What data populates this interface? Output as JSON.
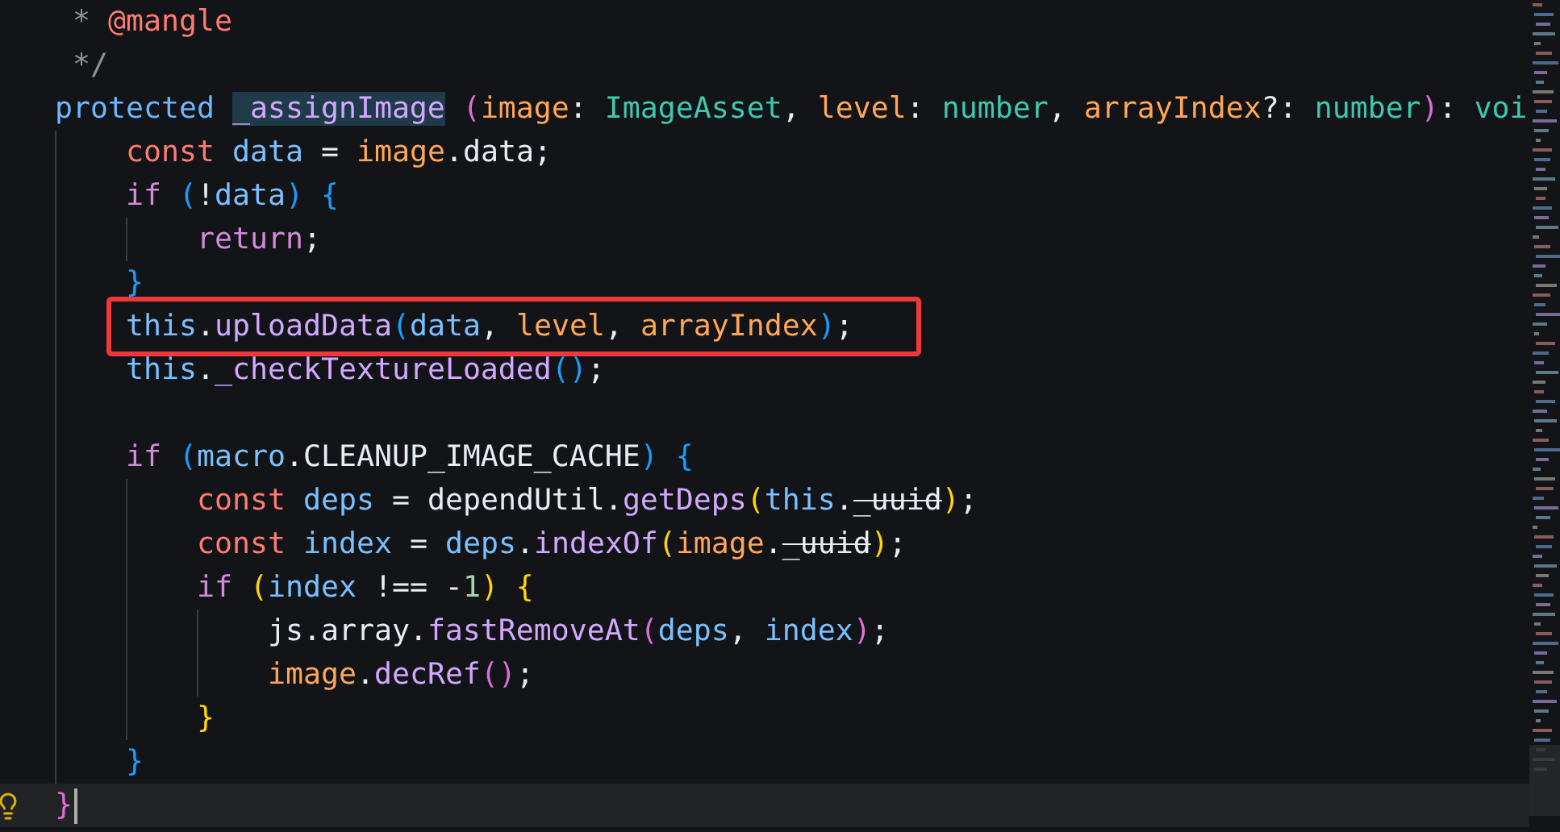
{
  "editor": {
    "lines": [
      {
        "current": false,
        "boxed": false,
        "tokens": [
          {
            "text": " * ",
            "kind": "comment"
          },
          {
            "text": "@mangle",
            "kind": "tag"
          }
        ]
      },
      {
        "current": false,
        "boxed": false,
        "tokens": [
          {
            "text": " */",
            "kind": "comment"
          }
        ]
      },
      {
        "current": false,
        "boxed": false,
        "tokens": [
          {
            "text": "protected ",
            "kind": "storage"
          },
          {
            "text": "_assignImage",
            "kind": "selection"
          },
          {
            "text": " (",
            "kind": "bracket2"
          },
          {
            "text": "image",
            "kind": "param"
          },
          {
            "text": ": ",
            "kind": "plain"
          },
          {
            "text": "ImageAsset",
            "kind": "type"
          },
          {
            "text": ", ",
            "kind": "plain"
          },
          {
            "text": "level",
            "kind": "param"
          },
          {
            "text": ": ",
            "kind": "plain"
          },
          {
            "text": "number",
            "kind": "type"
          },
          {
            "text": ", ",
            "kind": "plain"
          },
          {
            "text": "arrayIndex",
            "kind": "param"
          },
          {
            "text": "?: ",
            "kind": "plain"
          },
          {
            "text": "number",
            "kind": "type"
          },
          {
            "text": ")",
            "kind": "bracket2"
          },
          {
            "text": ": ",
            "kind": "plain"
          },
          {
            "text": "voi",
            "kind": "type"
          }
        ]
      },
      {
        "current": false,
        "boxed": false,
        "tokens": [
          {
            "text": "    const ",
            "kind": "keyword"
          },
          {
            "text": "data",
            "kind": "variable"
          },
          {
            "text": " = ",
            "kind": "plain"
          },
          {
            "text": "image",
            "kind": "param"
          },
          {
            "text": ".data;",
            "kind": "plain"
          }
        ]
      },
      {
        "current": false,
        "boxed": false,
        "tokens": [
          {
            "text": "    if",
            "kind": "control"
          },
          {
            "text": " (",
            "kind": "bracket3"
          },
          {
            "text": "!",
            "kind": "plain"
          },
          {
            "text": "data",
            "kind": "variable"
          },
          {
            "text": ")",
            "kind": "bracket3"
          },
          {
            "text": " {",
            "kind": "bracket3"
          }
        ]
      },
      {
        "current": false,
        "boxed": false,
        "tokens": [
          {
            "text": "        return",
            "kind": "control"
          },
          {
            "text": ";",
            "kind": "plain"
          }
        ]
      },
      {
        "current": false,
        "boxed": false,
        "tokens": [
          {
            "text": "    }",
            "kind": "bracket3"
          }
        ]
      },
      {
        "current": false,
        "boxed": true,
        "tokens": [
          {
            "text": "    this",
            "kind": "variable"
          },
          {
            "text": ".",
            "kind": "plain"
          },
          {
            "text": "uploadData",
            "kind": "function"
          },
          {
            "text": "(",
            "kind": "bracket3"
          },
          {
            "text": "data",
            "kind": "variable"
          },
          {
            "text": ", ",
            "kind": "plain"
          },
          {
            "text": "level",
            "kind": "param"
          },
          {
            "text": ", ",
            "kind": "plain"
          },
          {
            "text": "arrayIndex",
            "kind": "param"
          },
          {
            "text": ")",
            "kind": "bracket3"
          },
          {
            "text": ";",
            "kind": "plain"
          }
        ]
      },
      {
        "current": false,
        "boxed": false,
        "tokens": [
          {
            "text": "    this",
            "kind": "variable"
          },
          {
            "text": ".",
            "kind": "plain"
          },
          {
            "text": "_checkTextureLoaded",
            "kind": "function"
          },
          {
            "text": "()",
            "kind": "bracket3"
          },
          {
            "text": ";",
            "kind": "plain"
          }
        ]
      },
      {
        "kind": "blank"
      },
      {
        "current": false,
        "boxed": false,
        "tokens": [
          {
            "text": "    if",
            "kind": "control"
          },
          {
            "text": " (",
            "kind": "bracket3"
          },
          {
            "text": "macro",
            "kind": "variable"
          },
          {
            "text": ".CLEANUP_IMAGE_CACHE",
            "kind": "plain"
          },
          {
            "text": ")",
            "kind": "bracket3"
          },
          {
            "text": " {",
            "kind": "bracket3"
          }
        ]
      },
      {
        "current": false,
        "boxed": false,
        "tokens": [
          {
            "text": "        const ",
            "kind": "keyword"
          },
          {
            "text": "deps",
            "kind": "variable"
          },
          {
            "text": " = dependUtil.",
            "kind": "plain"
          },
          {
            "text": "getDeps",
            "kind": "function"
          },
          {
            "text": "(",
            "kind": "bracket1"
          },
          {
            "text": "this",
            "kind": "variable"
          },
          {
            "text": ".",
            "kind": "plain"
          },
          {
            "text": "_uuid",
            "kind": "deprecated"
          },
          {
            "text": ")",
            "kind": "bracket1"
          },
          {
            "text": ";",
            "kind": "plain"
          }
        ]
      },
      {
        "current": false,
        "boxed": false,
        "tokens": [
          {
            "text": "        const ",
            "kind": "keyword"
          },
          {
            "text": "index",
            "kind": "variable"
          },
          {
            "text": " = ",
            "kind": "plain"
          },
          {
            "text": "deps",
            "kind": "variable"
          },
          {
            "text": ".",
            "kind": "plain"
          },
          {
            "text": "indexOf",
            "kind": "function"
          },
          {
            "text": "(",
            "kind": "bracket1"
          },
          {
            "text": "image",
            "kind": "param"
          },
          {
            "text": ".",
            "kind": "plain"
          },
          {
            "text": "_uuid",
            "kind": "deprecated"
          },
          {
            "text": ")",
            "kind": "bracket1"
          },
          {
            "text": ";",
            "kind": "plain"
          }
        ]
      },
      {
        "current": false,
        "boxed": false,
        "tokens": [
          {
            "text": "        if",
            "kind": "control"
          },
          {
            "text": " (",
            "kind": "bracket1"
          },
          {
            "text": "index",
            "kind": "variable"
          },
          {
            "text": " !== -",
            "kind": "plain"
          },
          {
            "text": "1",
            "kind": "number"
          },
          {
            "text": ")",
            "kind": "bracket1"
          },
          {
            "text": " {",
            "kind": "bracket1"
          }
        ]
      },
      {
        "current": false,
        "boxed": false,
        "tokens": [
          {
            "text": "            js.array.",
            "kind": "plain"
          },
          {
            "text": "fastRemoveAt",
            "kind": "function"
          },
          {
            "text": "(",
            "kind": "bracket2"
          },
          {
            "text": "deps",
            "kind": "variable"
          },
          {
            "text": ", ",
            "kind": "plain"
          },
          {
            "text": "index",
            "kind": "variable"
          },
          {
            "text": ")",
            "kind": "bracket2"
          },
          {
            "text": ";",
            "kind": "plain"
          }
        ]
      },
      {
        "current": false,
        "boxed": false,
        "tokens": [
          {
            "text": "            image",
            "kind": "param"
          },
          {
            "text": ".",
            "kind": "plain"
          },
          {
            "text": "decRef",
            "kind": "function"
          },
          {
            "text": "()",
            "kind": "bracket2"
          },
          {
            "text": ";",
            "kind": "plain"
          }
        ]
      },
      {
        "current": false,
        "boxed": false,
        "tokens": [
          {
            "text": "        }",
            "kind": "bracket1"
          }
        ]
      },
      {
        "current": false,
        "boxed": false,
        "tokens": [
          {
            "text": "    }",
            "kind": "bracket3"
          }
        ]
      },
      {
        "current": true,
        "boxed": false,
        "tokens": [
          {
            "text": "}",
            "kind": "bracket2"
          }
        ]
      }
    ]
  }
}
